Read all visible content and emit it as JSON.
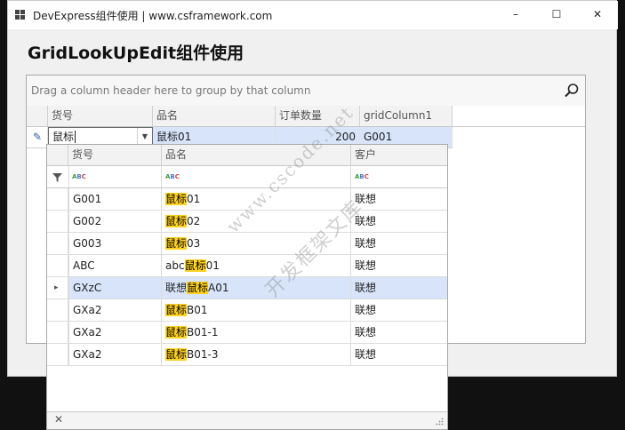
{
  "window": {
    "title": "DevExpress组件使用 | www.csframework.com",
    "minimize": "–",
    "maximize": "☐",
    "close": "✕"
  },
  "page": {
    "heading": "GridLookUpEdit组件使用"
  },
  "grid": {
    "group_panel_text": "Drag a column header here to group by that column",
    "columns": [
      "货号",
      "品名",
      "订单数量",
      "gridColumn1"
    ],
    "edit_row": {
      "indicator": "✎",
      "lookup_value": "鼠标",
      "name": "鼠标01",
      "qty": "200",
      "col1": "G001"
    }
  },
  "popup": {
    "columns": [
      "货号",
      "品名",
      "客户"
    ],
    "filter_icon": "filter-icon",
    "filter_glyph": "ABC",
    "search_term": "鼠标",
    "rows": [
      {
        "code": "G001",
        "pre": "",
        "hit": "鼠标",
        "post": "01",
        "customer": "联想",
        "selected": false
      },
      {
        "code": "G002",
        "pre": "",
        "hit": "鼠标",
        "post": "02",
        "customer": "联想",
        "selected": false
      },
      {
        "code": "G003",
        "pre": "",
        "hit": "鼠标",
        "post": "03",
        "customer": "联想",
        "selected": false
      },
      {
        "code": "ABC",
        "pre": "abc",
        "hit": "鼠标",
        "post": "01",
        "customer": "联想",
        "selected": false
      },
      {
        "code": "GXzC",
        "pre": "联想",
        "hit": "鼠标",
        "post": "A01",
        "customer": "联想",
        "selected": true
      },
      {
        "code": "GXa2",
        "pre": "",
        "hit": "鼠标",
        "post": "B01",
        "customer": "联想",
        "selected": false
      },
      {
        "code": "GXa2",
        "pre": "",
        "hit": "鼠标",
        "post": "B01-1",
        "customer": "联想",
        "selected": false
      },
      {
        "code": "GXa2",
        "pre": "",
        "hit": "鼠标",
        "post": "B01-3",
        "customer": "联想",
        "selected": false
      }
    ],
    "footer_close": "✕",
    "row_indicator": "▸"
  },
  "watermark": {
    "line1": "www.cscode.net",
    "line2": "开发框架文库"
  },
  "colors": {
    "selection": "#d7e4f9",
    "highlight": "#ffd21f",
    "border": "#a8a8a8"
  }
}
